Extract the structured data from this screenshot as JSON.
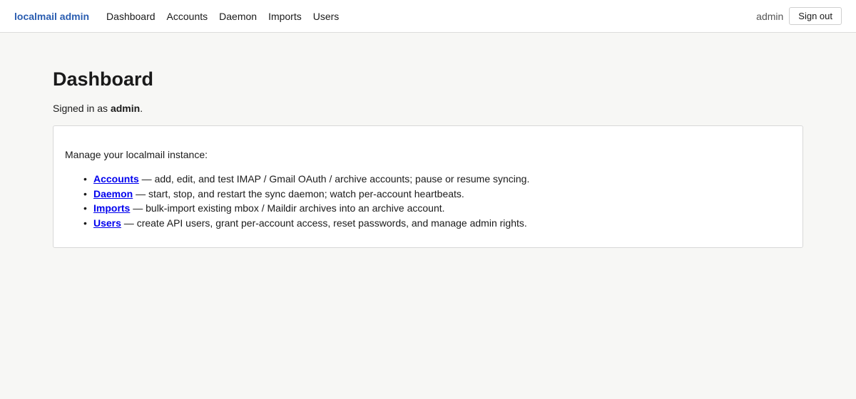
{
  "header": {
    "brand": "localmail admin",
    "nav": [
      "Dashboard",
      "Accounts",
      "Daemon",
      "Imports",
      "Users"
    ],
    "user": "admin",
    "signout_label": "Sign out"
  },
  "main": {
    "title": "Dashboard",
    "signed_prefix": "Signed in as ",
    "signed_user": "admin",
    "signed_suffix": ".",
    "card": {
      "intro": "Manage your localmail instance:",
      "items": [
        {
          "link": "Accounts",
          "desc": " — add, edit, and test IMAP / Gmail OAuth / archive accounts; pause or resume syncing."
        },
        {
          "link": "Daemon",
          "desc": " — start, stop, and restart the sync daemon; watch per-account heartbeats."
        },
        {
          "link": "Imports",
          "desc": " — bulk-import existing mbox / Maildir archives into an archive account."
        },
        {
          "link": "Users",
          "desc": " — create API users, grant per-account access, reset passwords, and manage admin rights."
        }
      ]
    }
  },
  "colors": {
    "brand": "#2a5db0",
    "link": "#0000ee",
    "background": "#f7f7f5"
  }
}
